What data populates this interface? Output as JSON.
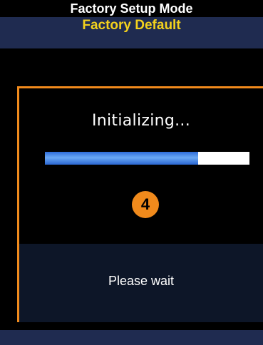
{
  "header": {
    "mode": "Factory Setup Mode",
    "title": "Factory Default"
  },
  "dialog": {
    "status": "Initializing...",
    "progress": 0.75,
    "step": "4",
    "message": "Please wait"
  },
  "colors": {
    "title_text": "#f3d11d",
    "title_bar": "#1f2b50",
    "highlight": "#f08a1c",
    "progress_fill": "#4a8ae8"
  }
}
